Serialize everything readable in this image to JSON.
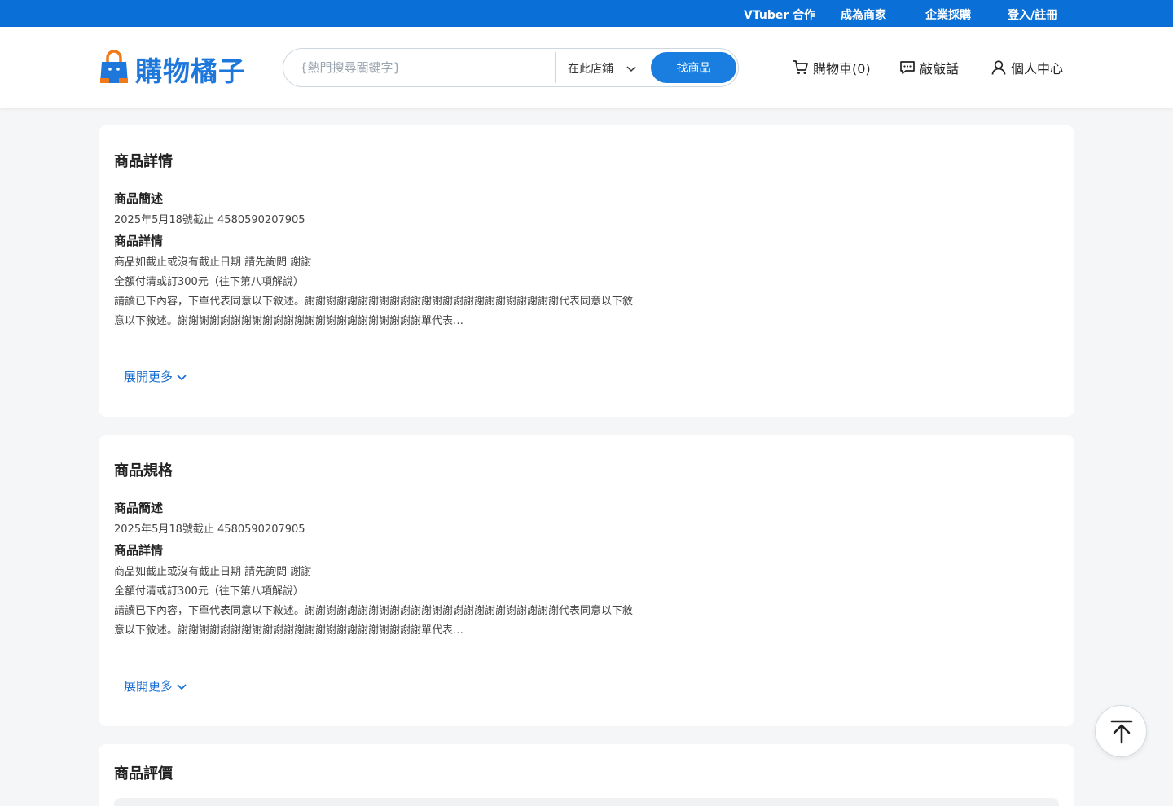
{
  "topbar": {
    "links": [
      "VTuber 合作",
      "成為商家",
      "企業採購",
      "登入/註冊"
    ]
  },
  "header": {
    "logo_text": "購物橘子",
    "search": {
      "placeholder": "{熱門搜尋關鍵字}",
      "scope": "在此店鋪",
      "button": "找商品"
    },
    "cart_label": "購物車(0)",
    "chat_label": "敲敲話",
    "account_label": "個人中心"
  },
  "sections": [
    {
      "title": "商品詳情",
      "summary_heading": "商品簡述",
      "summary_text": "2025年5月18號截止 4580590207905",
      "detail_heading": "商品詳情",
      "lines": [
        "商品如截止或沒有截止日期 請先詢問 謝謝",
        "全額付清或訂300元（往下第八項解說）",
        "請讀已下內容，下單代表同意以下敘述。謝謝謝謝謝謝謝謝謝謝謝謝謝謝謝謝謝謝謝謝謝謝謝謝代表同意以下敘",
        "意以下敘述。謝謝謝謝謝謝謝謝謝謝謝謝謝謝謝謝謝謝謝謝謝謝謝單代表…"
      ],
      "more_label": "展開更多"
    },
    {
      "title": "商品規格",
      "summary_heading": "商品簡述",
      "summary_text": "2025年5月18號截止 4580590207905",
      "detail_heading": "商品詳情",
      "lines": [
        "商品如截止或沒有截止日期 請先詢問 謝謝",
        "全額付清或訂300元（往下第八項解說）",
        "請讀已下內容，下單代表同意以下敘述。謝謝謝謝謝謝謝謝謝謝謝謝謝謝謝謝謝謝謝謝謝謝謝謝代表同意以下敘",
        "意以下敘述。謝謝謝謝謝謝謝謝謝謝謝謝謝謝謝謝謝謝謝謝謝謝謝單代表…"
      ],
      "more_label": "展開更多"
    }
  ],
  "reviews": {
    "title": "商品評價"
  },
  "colors": {
    "brand": "#0a6fd6",
    "accent": "#1a7ee0",
    "logo_bag": "#1e78dc",
    "logo_handle": "#f07a1a"
  },
  "icons": [
    "cart-icon",
    "chat-icon",
    "user-icon",
    "chevron-down-icon",
    "back-to-top-icon",
    "logo-bag-icon"
  ]
}
